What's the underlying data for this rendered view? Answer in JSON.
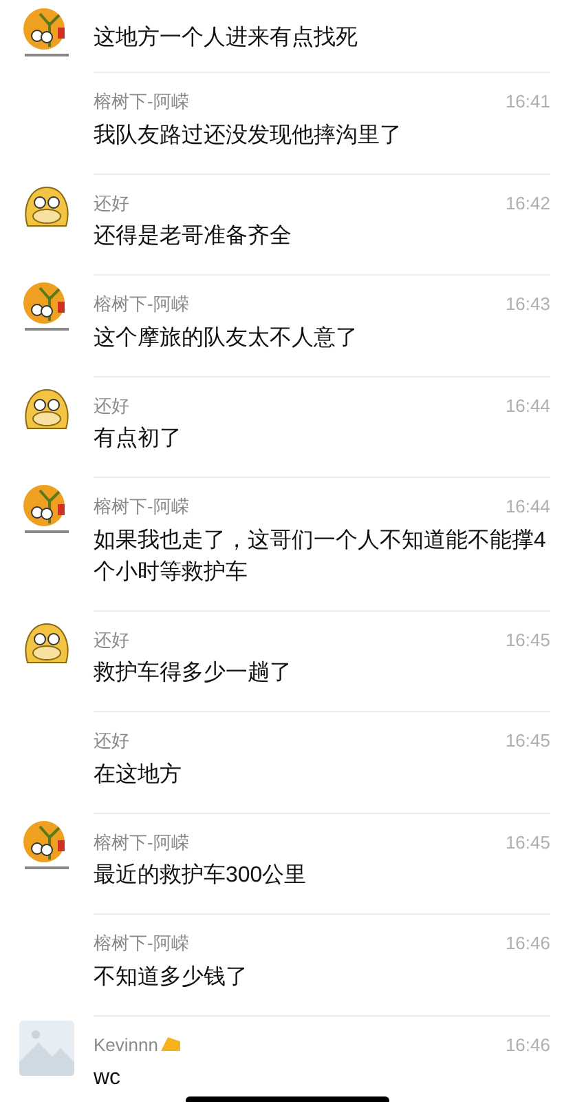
{
  "messages": [
    {
      "kind": "tree",
      "text": "这地方一个人进来有点找死"
    },
    {
      "kind": "none",
      "name": "榕树下-阿嵘",
      "time": "16:41",
      "text": "我队友路过还没发现他摔沟里了"
    },
    {
      "kind": "dog",
      "name": "还好",
      "time": "16:42",
      "text": "还得是老哥准备齐全"
    },
    {
      "kind": "tree",
      "name": "榕树下-阿嵘",
      "time": "16:43",
      "text": "这个摩旅的队友太不人意了"
    },
    {
      "kind": "dog",
      "name": "还好",
      "time": "16:44",
      "text": "有点初了"
    },
    {
      "kind": "tree",
      "name": "榕树下-阿嵘",
      "time": "16:44",
      "text": "如果我也走了，这哥们一个人不知道能不能撑4个小时等救护车"
    },
    {
      "kind": "dog",
      "name": "还好",
      "time": "16:45",
      "text": "救护车得多少一趟了"
    },
    {
      "kind": "none",
      "name": "还好",
      "time": "16:45",
      "text": "在这地方"
    },
    {
      "kind": "tree",
      "name": "榕树下-阿嵘",
      "time": "16:45",
      "text": "最近的救护车300公里"
    },
    {
      "kind": "none",
      "name": "榕树下-阿嵘",
      "time": "16:46",
      "text": "不知道多少钱了"
    },
    {
      "kind": "placeholder",
      "name": "Kevinnn",
      "badge": true,
      "time": "16:46",
      "text": "wc"
    }
  ]
}
